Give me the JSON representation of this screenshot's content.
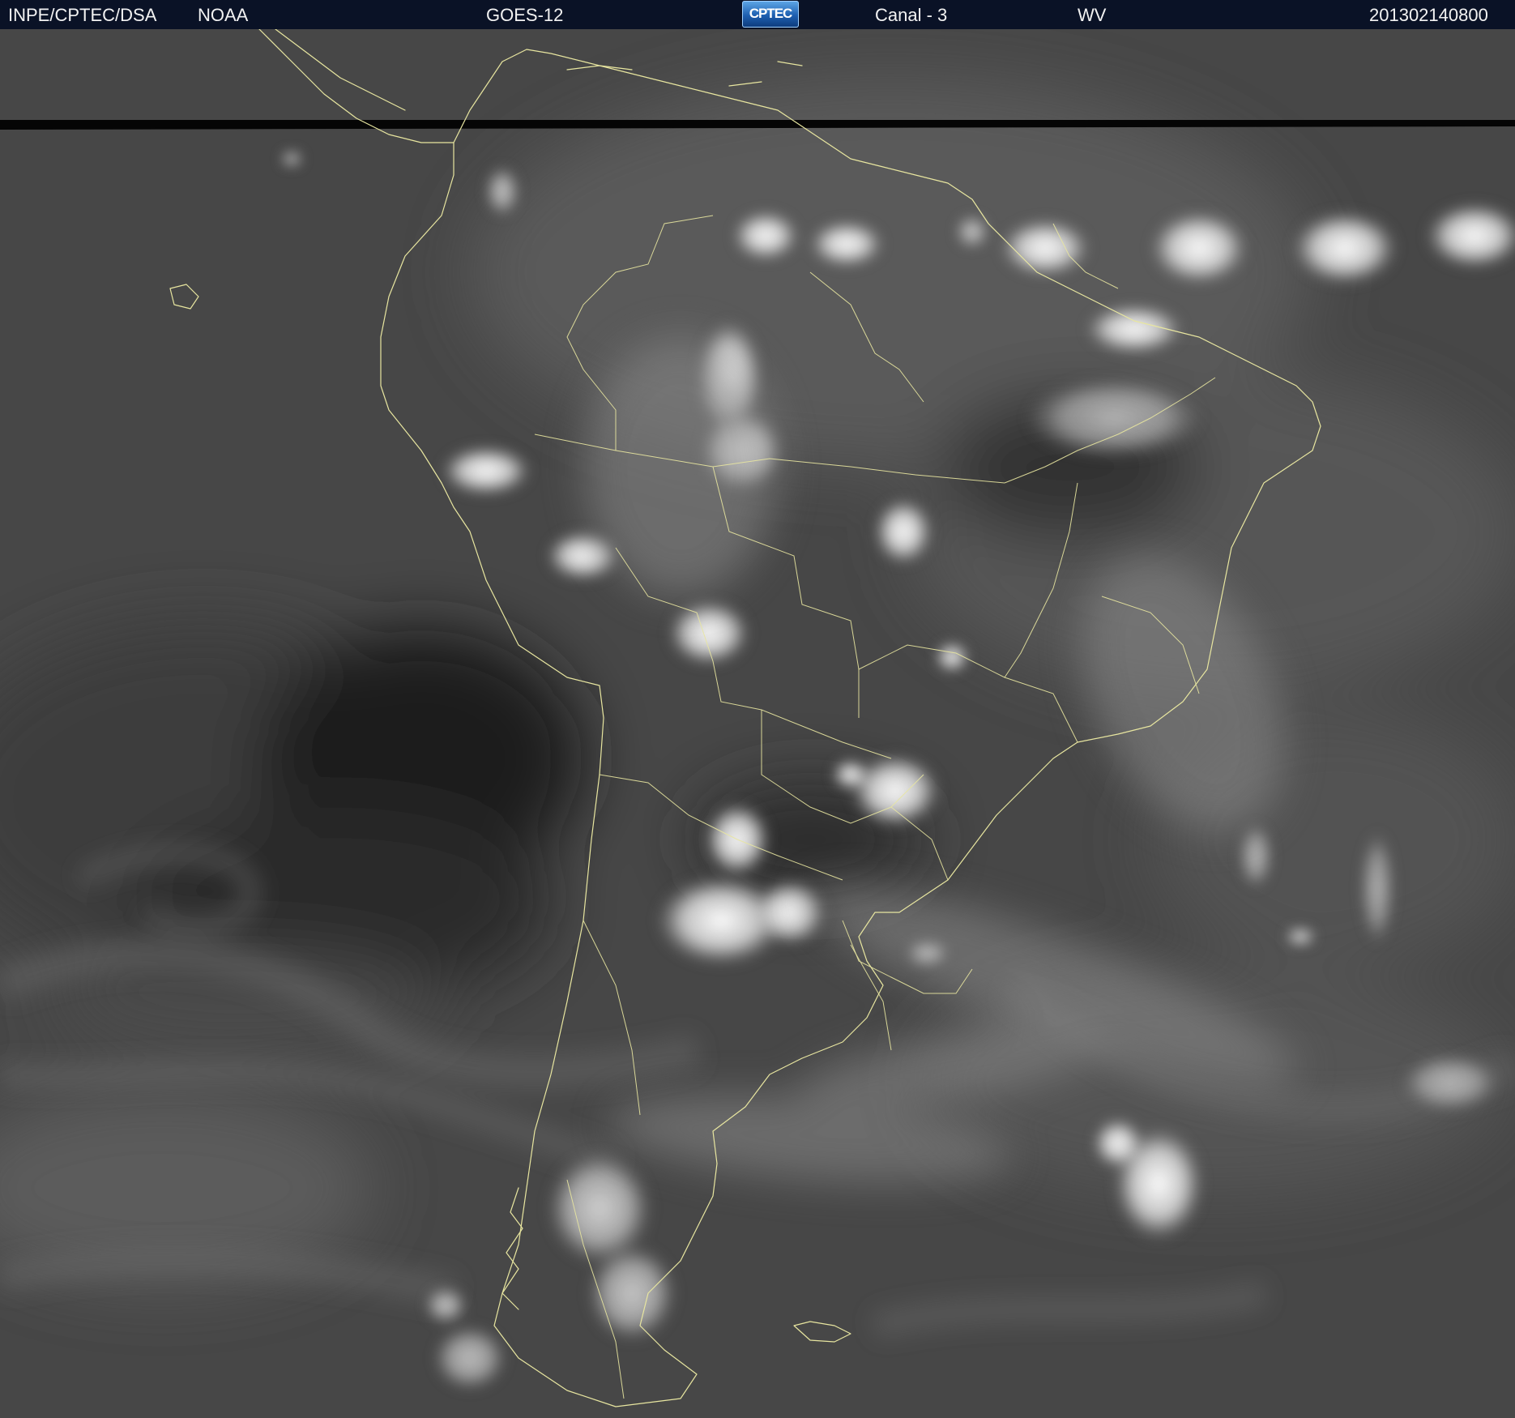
{
  "header": {
    "source": "INPE/CPTEC/DSA",
    "agency": "NOAA",
    "satellite": "GOES-12",
    "logo_text": "CPTEC",
    "channel": "Canal - 3",
    "band": "WV",
    "timestamp": "201302140800"
  },
  "colors": {
    "header_bg": "#0a1226",
    "coastline": "#e8e6a0",
    "background_dark": "#2e2e2e",
    "cloud_white": "#f2f2f2"
  },
  "icons": {
    "logo": "cptec-logo-icon"
  }
}
